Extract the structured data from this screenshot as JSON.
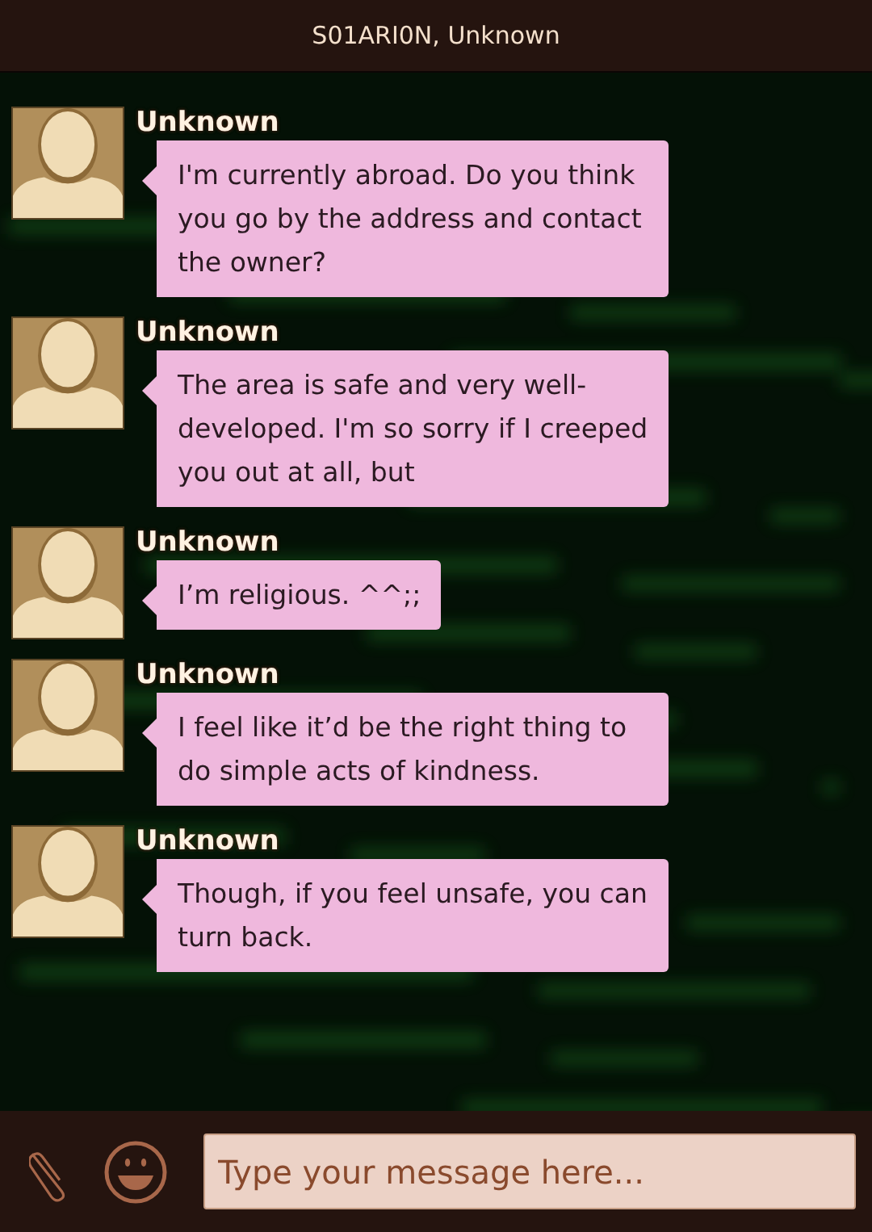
{
  "header": {
    "title": "S01ARI0N, Unknown"
  },
  "messages": [
    {
      "sender": "Unknown",
      "text": "I'm currently abroad. Do you think you go by the address and contact the owner?"
    },
    {
      "sender": "Unknown",
      "text": "The area is safe and very well-developed. I'm so sorry if I creeped you out at all, but"
    },
    {
      "sender": "Unknown",
      "text": "I’m religious. ^^;;"
    },
    {
      "sender": "Unknown",
      "text": "I feel like it’d be the right thing to do simple acts of kindness."
    },
    {
      "sender": "Unknown",
      "text": "Though, if you feel unsafe, you can turn back."
    }
  ],
  "composer": {
    "placeholder": "Type your message here..."
  }
}
